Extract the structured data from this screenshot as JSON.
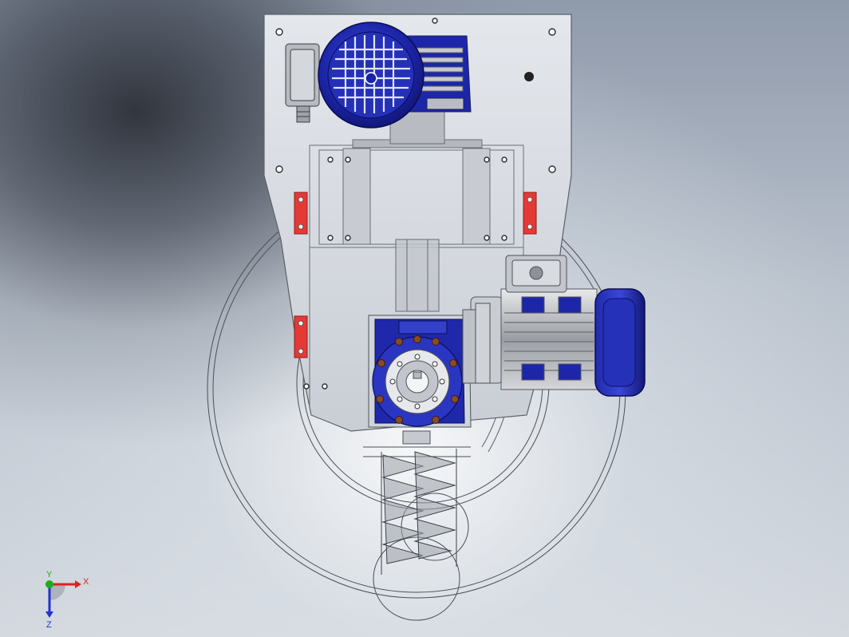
{
  "viewport": {
    "background_top": "#8f9aab",
    "background_bottom": "#d4d9e0"
  },
  "model": {
    "frame_color": "#d9dde3",
    "motor_blue": "#1a22a8",
    "motor_silver": "#bfc3c9",
    "accent_red": "#e53935",
    "wire_color": "#555a62"
  },
  "triad": {
    "x_label": "X",
    "y_label": "Y",
    "z_label": "Z",
    "x_color": "#dd2222",
    "y_color": "#22aa22",
    "z_color": "#2233cc"
  }
}
